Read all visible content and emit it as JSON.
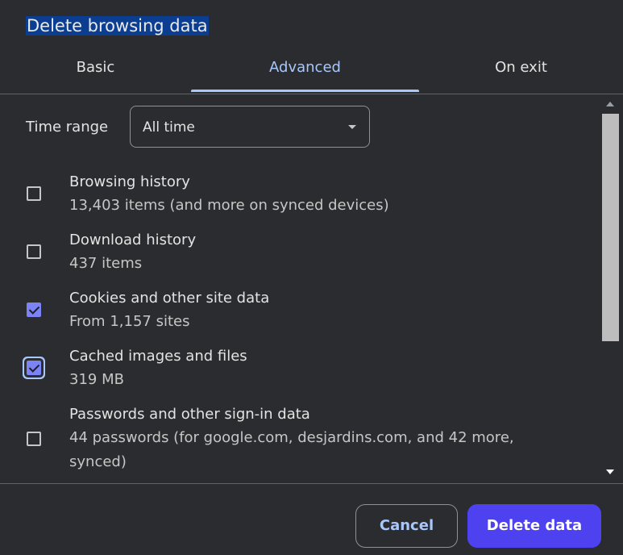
{
  "dialog": {
    "title": "Delete browsing data"
  },
  "tabs": [
    {
      "label": "Basic",
      "active": false
    },
    {
      "label": "Advanced",
      "active": true
    },
    {
      "label": "On exit",
      "active": false
    }
  ],
  "time_range": {
    "label": "Time range",
    "value": "All time"
  },
  "items": [
    {
      "title": "Browsing history",
      "subtitle": "13,403 items (and more on synced devices)",
      "checked": false
    },
    {
      "title": "Download history",
      "subtitle": "437 items",
      "checked": false
    },
    {
      "title": "Cookies and other site data",
      "subtitle": "From 1,157 sites",
      "checked": true
    },
    {
      "title": "Cached images and files",
      "subtitle": "319 MB",
      "checked": true,
      "focused": true
    },
    {
      "title": "Passwords and other sign-in data",
      "subtitle": "44 passwords (for google.com, desjardins.com, and 42 more, synced)",
      "checked": false
    }
  ],
  "footer": {
    "cancel_label": "Cancel",
    "delete_label": "Delete data"
  },
  "colors": {
    "accent": "#a8c7fa",
    "primary_button": "#4e42f0",
    "checkbox_checked": "#7b83f5",
    "background": "#2b2c2f"
  }
}
